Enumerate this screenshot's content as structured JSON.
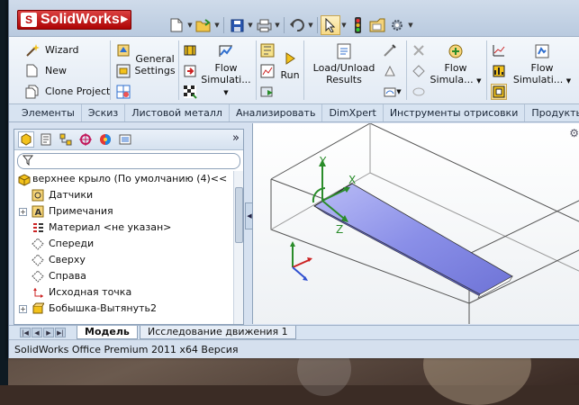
{
  "app": {
    "logo_text": "SolidWorks",
    "brand_color": "#c00000"
  },
  "quick_access": {
    "icons": [
      "new-icon",
      "open-icon",
      "save-icon",
      "print-icon",
      "undo-icon",
      "select-icon",
      "rebuild-icon",
      "file-properties-icon",
      "options-icon"
    ]
  },
  "ribbon": {
    "wizard": "Wizard",
    "new": "New",
    "clone_project": "Clone Project",
    "general_settings_1": "General",
    "general_settings_2": "Settings",
    "flow_simulation_1_a": "Flow",
    "flow_simulation_1_b": "Simulati...",
    "run": "Run",
    "load_unload_1": "Load/Unload",
    "load_unload_2": "Results",
    "flow_simulation_2_a": "Flow",
    "flow_simulation_2_b": "Simula...",
    "flow_simulation_3_a": "Flow",
    "flow_simulation_3_b": "Simulati..."
  },
  "command_tabs": [
    "Элементы",
    "Эскиз",
    "Листовой металл",
    "Анализировать",
    "DimXpert",
    "Инструменты отрисовки",
    "Продукты"
  ],
  "feature_tree": {
    "root": "верхнее крыло  (По умолчанию (4)<<",
    "items": [
      {
        "label": "Датчики",
        "icon": "sensors-icon",
        "expandable": false
      },
      {
        "label": "Примечания",
        "icon": "annotations-icon",
        "expandable": true
      },
      {
        "label": "Материал <не указан>",
        "icon": "material-icon",
        "expandable": false
      },
      {
        "label": "Спереди",
        "icon": "plane-icon",
        "expandable": false
      },
      {
        "label": "Сверху",
        "icon": "plane-icon",
        "expandable": false
      },
      {
        "label": "Справа",
        "icon": "plane-icon",
        "expandable": false
      },
      {
        "label": "Исходная точка",
        "icon": "origin-icon",
        "expandable": false
      },
      {
        "label": "Бобышка-Вытянуть2",
        "icon": "boss-extrude-icon",
        "expandable": true
      }
    ]
  },
  "panel_more": "»",
  "viewport": {
    "triad_x": "X",
    "triad_y": "Y",
    "triad_z": "Z",
    "model_color": "#8a8fe8"
  },
  "bottom_tabs": [
    "Модель",
    "Исследование движения 1"
  ],
  "status": "SolidWorks Office Premium 2011 x64 Версия"
}
